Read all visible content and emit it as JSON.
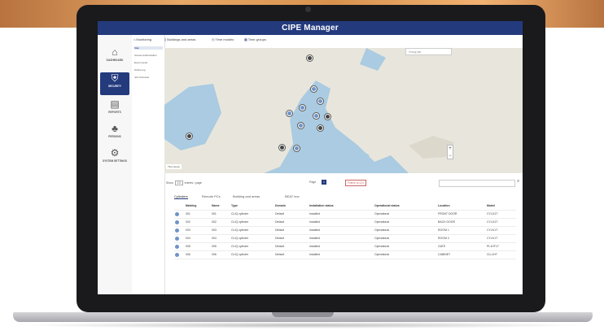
{
  "app": {
    "title": "CIPE Manager"
  },
  "sidebar": {
    "items": [
      {
        "label": "DASHBOARD",
        "icon": "home-icon"
      },
      {
        "label": "SECURITY",
        "icon": "shield-icon"
      },
      {
        "label": "REPORTS",
        "icon": "report-icon"
      },
      {
        "label": "PERSONS",
        "icon": "persons-icon"
      },
      {
        "label": "SYSTEM SETTINGS",
        "icon": "gear-icon"
      }
    ]
  },
  "subnav": {
    "items": [
      "Map",
      "Access authorization",
      "Event report",
      "Online log",
      "Job Overview"
    ]
  },
  "tabs": [
    {
      "label": "Monitoring",
      "icon": "monitor-icon"
    },
    {
      "label": "Buildings and areas",
      "icon": "building-icon"
    },
    {
      "label": "Time models",
      "icon": "clock-icon"
    },
    {
      "label": "Time groups",
      "icon": "calendar-icon"
    }
  ],
  "map": {
    "select_placeholder": "Group pin",
    "zoom_in": "+",
    "zoom_out": "−",
    "badge": "Tiles layout"
  },
  "controls": {
    "show_label": "Show",
    "show_value": "10",
    "per_page": "entries / page",
    "page_label": "Page",
    "page_value": "1",
    "filters_label": "Filters on (0)",
    "search_icon": "search-icon"
  },
  "subtabs": [
    "Cylinders",
    "Remote PCs",
    "Building and areas",
    "BEAT box"
  ],
  "table": {
    "headers": [
      "Marking",
      "Name",
      "Type",
      "Domain",
      "Installation status",
      "Operational status",
      "Location",
      "Model"
    ],
    "rows": [
      [
        "001",
        "001",
        "CLIQ cylinder",
        "Default",
        "Installed",
        "Operational",
        "FRONT DOOR",
        "CYLG1T"
      ],
      [
        "002",
        "002",
        "CLIQ cylinder",
        "Default",
        "Installed",
        "Operational",
        "BACK DOOR",
        "CYLG1T"
      ],
      [
        "003",
        "003",
        "CLIQ cylinder",
        "Default",
        "Installed",
        "Operational",
        "ROOM 1",
        "CYLK1T"
      ],
      [
        "004",
        "004",
        "CLIQ cylinder",
        "Default",
        "Installed",
        "Operational",
        "ROOM 2",
        "CYLK1T"
      ],
      [
        "005",
        "005",
        "CLIQ cylinder",
        "Default",
        "Installed",
        "Operational",
        "GATE",
        "PL1HT1T"
      ],
      [
        "006",
        "006",
        "CLIQ cylinder",
        "Default",
        "Installed",
        "Operational",
        "CABINET",
        "CLL1HT"
      ]
    ]
  },
  "colors": {
    "header": "#233a7d",
    "accent": "#233a7d",
    "map_water": "#aacbe1",
    "map_land": "#e8e6dc",
    "marker_blue": "#6f93c8",
    "marker_dark": "#444444"
  }
}
